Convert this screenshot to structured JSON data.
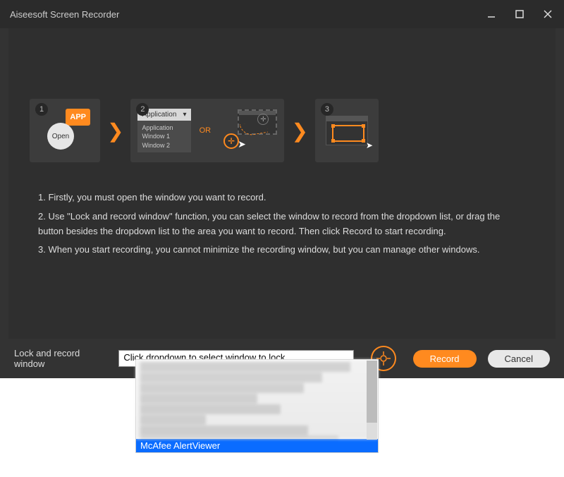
{
  "window": {
    "title": "Aiseesoft Screen Recorder"
  },
  "steps": {
    "s1": {
      "num": "1",
      "open": "Open",
      "app": "APP"
    },
    "s2": {
      "num": "2",
      "dd_label": "Application",
      "options": [
        "Application",
        "Window 1",
        "Window 2"
      ],
      "or": "OR"
    },
    "s3": {
      "num": "3"
    }
  },
  "instructions": {
    "l1": "1. Firstly, you must open the window you want to record.",
    "l2": "2. Use \"Lock and record window\" function, you can select the window to record from the dropdown list, or drag the button besides the dropdown list to the area you want to record. Then click Record to start recording.",
    "l3": "3. When you start recording, you cannot minimize the recording window, but you can manage other windows."
  },
  "bottom": {
    "label": "Lock and record window",
    "placeholder": "Click dropdown to select window to lock",
    "record": "Record",
    "cancel": "Cancel"
  },
  "dropdown": {
    "selected": "McAfee AlertViewer"
  }
}
